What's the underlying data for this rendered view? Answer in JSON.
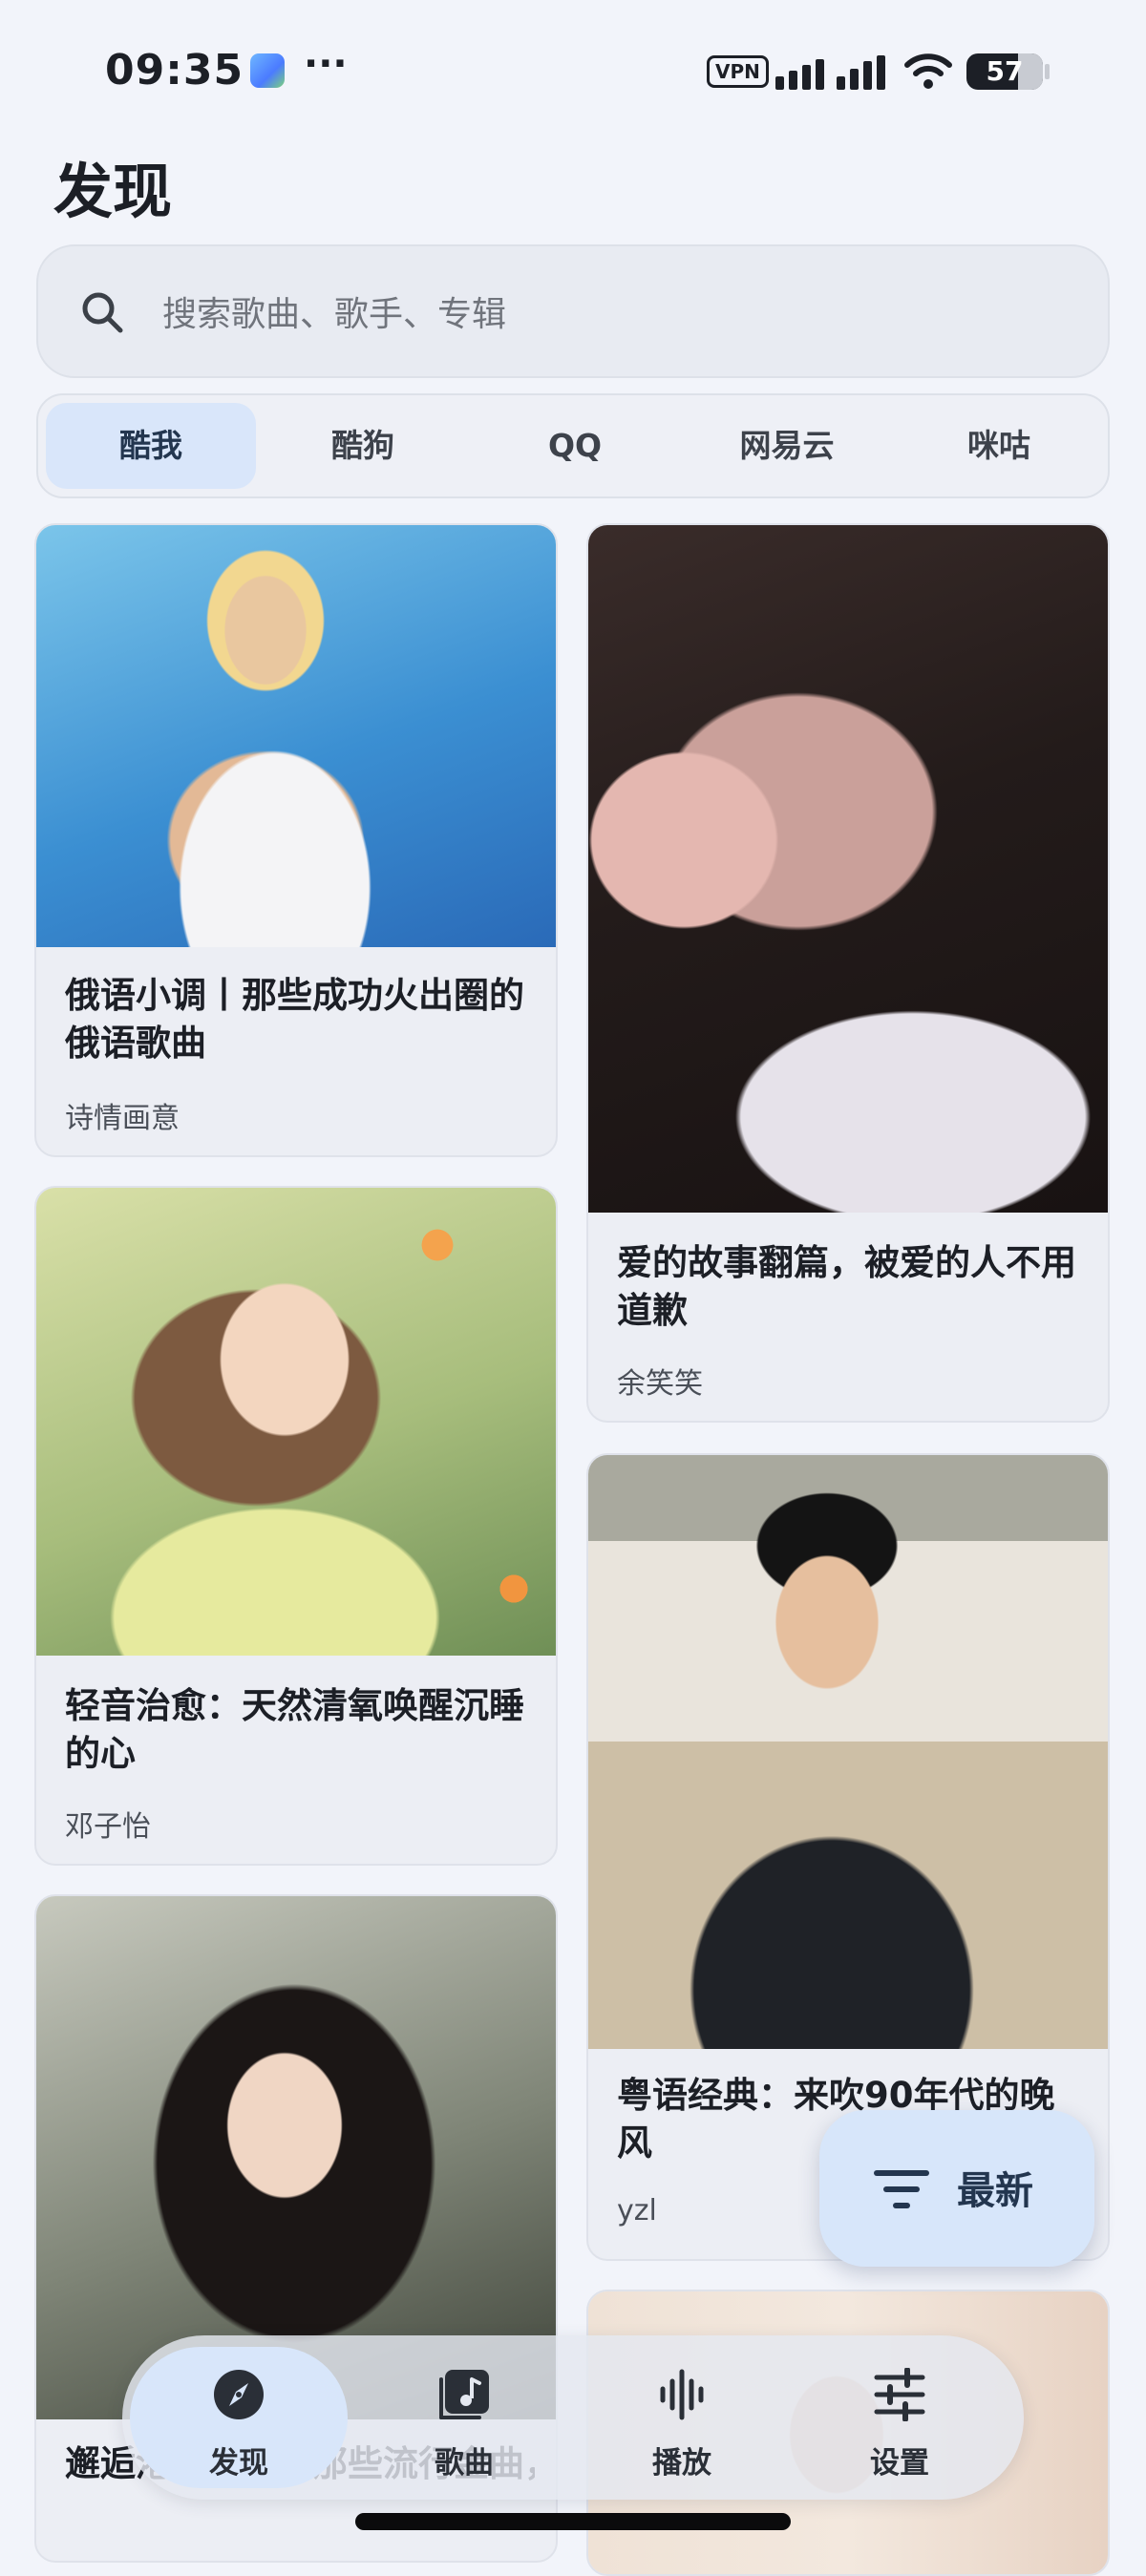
{
  "status": {
    "time": "09:35",
    "more": "···",
    "vpn": "VPN",
    "battery": "57"
  },
  "page": {
    "title": "发现"
  },
  "search": {
    "placeholder": "搜索歌曲、歌手、专辑"
  },
  "tabs": [
    {
      "label": "酷我",
      "active": true
    },
    {
      "label": "酷狗",
      "active": false
    },
    {
      "label": "QQ",
      "active": false
    },
    {
      "label": "网易云",
      "active": false
    },
    {
      "label": "咪咕",
      "active": false
    }
  ],
  "cards": [
    {
      "title": "俄语小调丨那些成功火出圈的俄语歌曲",
      "author": "诗情画意"
    },
    {
      "title": "爱的故事翻篇，被爱的人不用道歉",
      "author": "余笑笑"
    },
    {
      "title": "轻音治愈：天然清氧唤醒沉睡的心",
      "author": "邓子怡"
    },
    {
      "title": "粤语经典：来吹90年代的晚风",
      "author": "yzl"
    },
    {
      "title": "邂逅港乐：重温那些流行金曲，听见时光里的回忆，奔赴往昔岁月",
      "author": ""
    },
    {
      "title": "",
      "author": ""
    }
  ],
  "fab": {
    "label": "最新",
    "icon": "filter-icon"
  },
  "nav": [
    {
      "label": "发现",
      "icon": "compass-icon",
      "active": true
    },
    {
      "label": "歌曲",
      "icon": "music-note-icon",
      "active": false
    },
    {
      "label": "播放",
      "icon": "waveform-icon",
      "active": false
    },
    {
      "label": "设置",
      "icon": "sliders-icon",
      "active": false
    }
  ]
}
